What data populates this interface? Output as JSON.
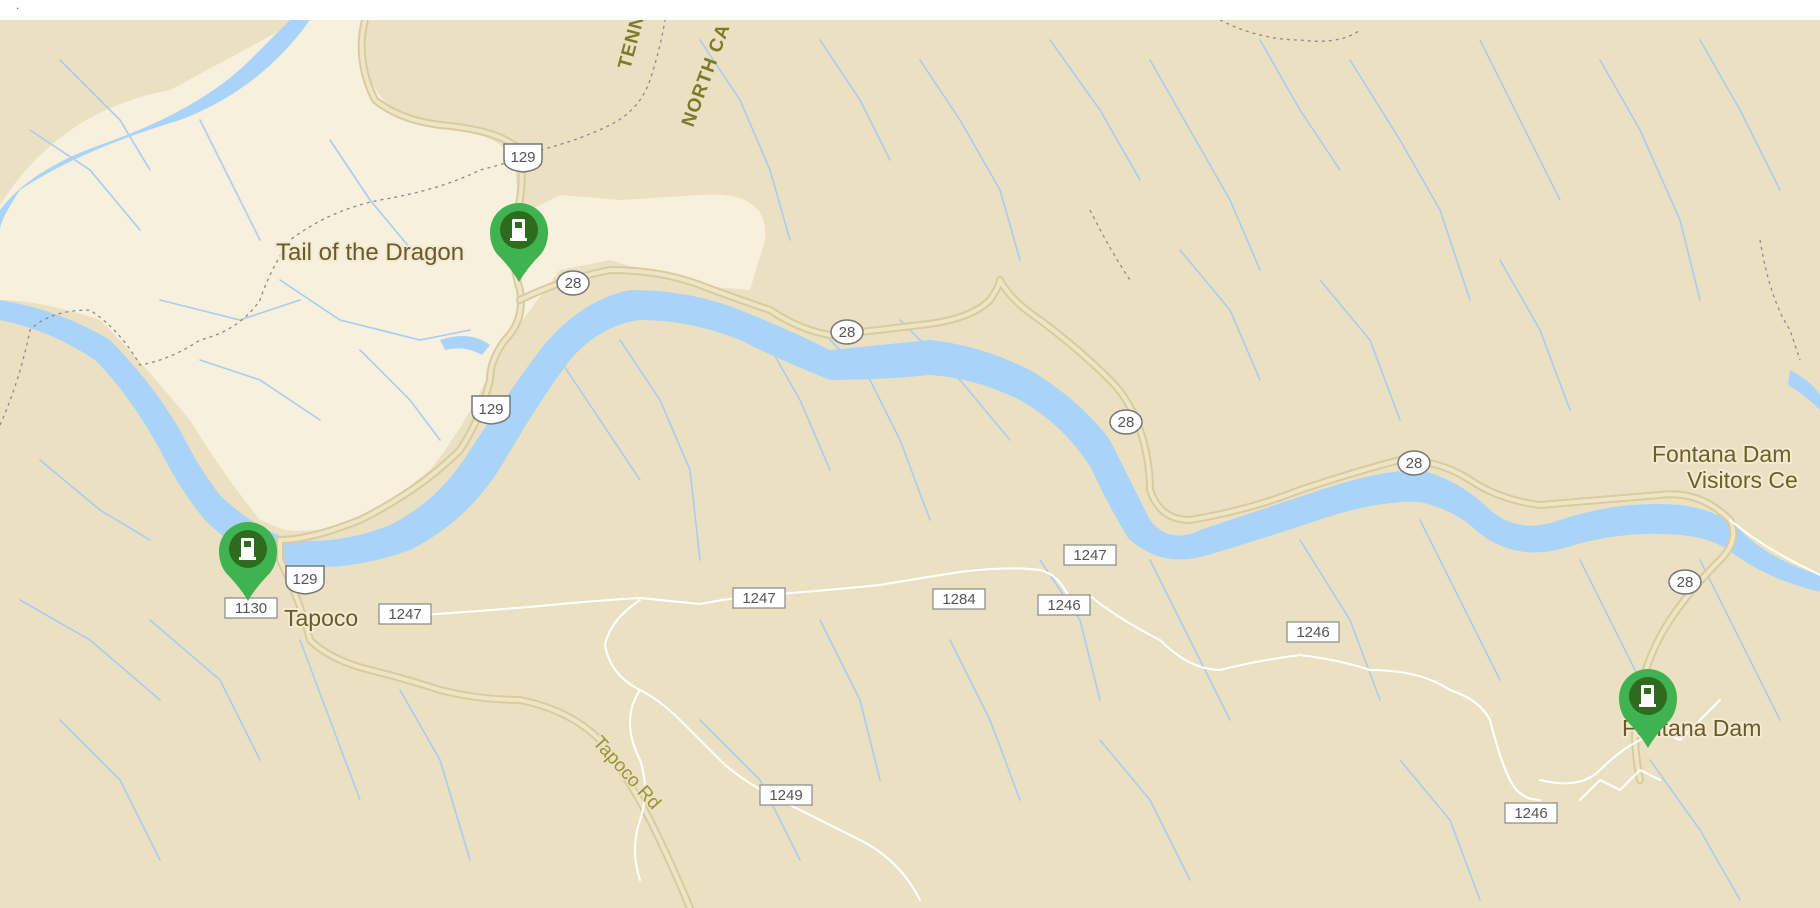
{
  "top_strip": {
    "mark": "."
  },
  "map": {
    "colors": {
      "land": "#ebe1c2",
      "park": "#f7f0dc",
      "water": "#aad3fa",
      "stream": "#a8cdf0",
      "highway": "#ddcfa6",
      "minor_road": "#ffffff",
      "marker": "#3fb34f",
      "marker_icon_bg": "#2e6b1f"
    },
    "labels": {
      "tail_of_the_dragon": "Tail of the Dragon",
      "tapoco": "Tapoco",
      "fontana_dam_visitors_line1": "Fontana Dam",
      "fontana_dam_visitors_line2": "Visitors Ce",
      "fontana_dam": "Fontana Dam",
      "tapoco_rd": "Tapoco Rd",
      "state_tenn": "TENN",
      "state_north_carolina": "NORTH CA"
    },
    "us_shields": [
      {
        "id": "us129-north",
        "text": "129"
      },
      {
        "id": "us129-mid",
        "text": "129"
      },
      {
        "id": "us129-south",
        "text": "129"
      }
    ],
    "state_shields": [
      {
        "id": "nc28-a",
        "text": "28"
      },
      {
        "id": "nc28-b",
        "text": "28"
      },
      {
        "id": "nc28-c",
        "text": "28"
      },
      {
        "id": "nc28-d",
        "text": "28"
      },
      {
        "id": "nc28-e",
        "text": "28"
      }
    ],
    "route_boxes": [
      {
        "id": "sr1130",
        "text": "1130"
      },
      {
        "id": "sr1247-a",
        "text": "1247"
      },
      {
        "id": "sr1247-b",
        "text": "1247"
      },
      {
        "id": "sr1247-c",
        "text": "1247"
      },
      {
        "id": "sr1284",
        "text": "1284"
      },
      {
        "id": "sr1246-a",
        "text": "1246"
      },
      {
        "id": "sr1246-b",
        "text": "1246"
      },
      {
        "id": "sr1246-c",
        "text": "1246"
      },
      {
        "id": "sr1249",
        "text": "1249"
      }
    ],
    "markers": [
      {
        "id": "gas-tail-of-the-dragon",
        "icon": "gas-station-icon"
      },
      {
        "id": "gas-tapoco",
        "icon": "gas-station-icon"
      },
      {
        "id": "gas-fontana-dam",
        "icon": "gas-station-icon"
      }
    ]
  }
}
